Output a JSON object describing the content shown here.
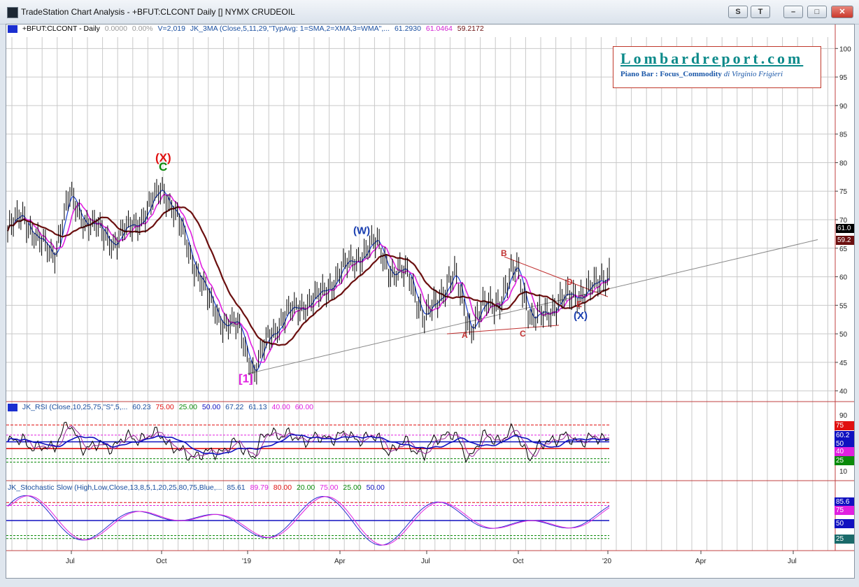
{
  "window": {
    "title": "TradeStation Chart Analysis - +BFUT:CLCONT Daily [] NYMX CRUDEOIL",
    "buttons": [
      "S",
      "T",
      "–",
      "□",
      "✕"
    ]
  },
  "price_legend": {
    "symbol": "+BFUT:CLCONT - Daily",
    "change": "0.0000",
    "change_pct": "0.00%",
    "volume": "V=2,019",
    "indicator": "JK_3MA (Close,5,11,29,\"TypAvg: 1=SMA,2=XMA,3=WMA\",...",
    "v1": "61.2930",
    "v2": "61.0464",
    "v3": "59.2172"
  },
  "rsi_legend": {
    "name": "JK_RSI (Close,10,25,75,\"S\",5,...",
    "values": [
      "60.23",
      "75.00",
      "25.00",
      "50.00",
      "67.22",
      "61.13",
      "40.00",
      "60.00"
    ]
  },
  "stoch_legend": {
    "name": "JK_Stochastic Slow (High,Low,Close,13,8,5,1,20,25,80,75,Blue,...",
    "values": [
      "85.61",
      "89.79",
      "80.00",
      "20.00",
      "75.00",
      "25.00",
      "50.00"
    ]
  },
  "lombard": {
    "title": "Lombardreport.com",
    "subtitle": "Piano Bar : Focus_Commodity",
    "author": "di Virginio Frigieri"
  },
  "price_axis": [
    "100",
    "95",
    "90",
    "85",
    "80",
    "75",
    "70",
    "65",
    "60",
    "55",
    "50",
    "45",
    "40"
  ],
  "price_tags": [
    "61.0",
    "59.2"
  ],
  "rsi_axis": [
    "90",
    "10"
  ],
  "rsi_tags": [
    "75",
    "60.2",
    "50",
    "40",
    "25"
  ],
  "stoch_tags": [
    "85.6",
    "75",
    "50",
    "25"
  ],
  "time_axis": [
    "Jul",
    "Oct",
    "'19",
    "Apr",
    "Jul",
    "Oct",
    "'20",
    "Apr",
    "Jul"
  ],
  "wave_labels": [
    "(X)",
    "C",
    "(W)",
    "[1]",
    "A",
    "B",
    "C",
    "D",
    "E",
    "(X)"
  ],
  "colors": {
    "magenta": "#e020e0",
    "brown": "#6b0f0f",
    "blue": "#1010c0",
    "red": "#e01010",
    "green": "#0a8a0a"
  },
  "chart_data": {
    "type": "line",
    "title": "",
    "x": [
      "2018-05-01",
      "2018-05-15",
      "2018-06-01",
      "2018-06-15",
      "2018-07-01",
      "2018-07-15",
      "2018-08-01",
      "2018-08-15",
      "2018-09-01",
      "2018-09-15",
      "2018-10-03",
      "2018-10-15",
      "2018-11-01",
      "2018-11-15",
      "2018-12-01",
      "2018-12-15",
      "2018-12-24",
      "2019-01-15",
      "2019-02-01",
      "2019-02-15",
      "2019-03-01",
      "2019-03-15",
      "2019-04-01",
      "2019-04-15",
      "2019-04-23",
      "2019-05-15",
      "2019-06-01",
      "2019-06-12",
      "2019-07-01",
      "2019-07-15",
      "2019-08-07",
      "2019-08-20",
      "2019-09-01",
      "2019-09-16",
      "2019-10-03",
      "2019-10-15",
      "2019-11-01",
      "2019-11-15",
      "2019-12-01",
      "2019-12-20"
    ],
    "series": [
      {
        "values": [
          68,
          71,
          66,
          64,
          74,
          70,
          68,
          66,
          69,
          71,
          76,
          70,
          63,
          56,
          52,
          51,
          43,
          50,
          53,
          55,
          56,
          59,
          62,
          64,
          66,
          60,
          61,
          52,
          57,
          60,
          51,
          55,
          56,
          62,
          52,
          54,
          56,
          57,
          58,
          61
        ]
      }
    ],
    "ylim": [
      38,
      102
    ],
    "annotations": [
      "(X)",
      "C",
      "(W)",
      "[1]",
      "A",
      "B",
      "C",
      "D",
      "E",
      "(X)"
    ]
  }
}
